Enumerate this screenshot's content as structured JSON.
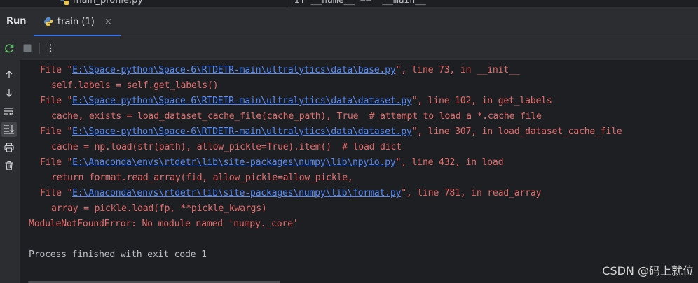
{
  "editor_strip": {
    "left_file": "main_profile.py",
    "right_code": "if __name__ == '__main__'"
  },
  "run_window": {
    "title": "Run",
    "tab_label": "train (1)",
    "tab_close": "×"
  },
  "icons": {
    "rerun": "rerun-icon",
    "stop": "stop-icon",
    "more": "more-vertical-icon",
    "up": "arrow-up-icon",
    "down": "arrow-down-icon",
    "wrap": "soft-wrap-icon",
    "scroll_end": "scroll-to-end-icon",
    "print": "print-icon",
    "clear": "trash-icon"
  },
  "colors": {
    "error": "#e06c6c",
    "link": "#548af7",
    "normal": "#bcbec4",
    "accent": "#3574f0"
  },
  "console": {
    "lines": [
      {
        "pre": "File \"",
        "link": "E:\\Space-python\\Space-6\\RTDETR-main\\ultralytics\\data\\base.py",
        "post": "\", line 73, in __init__"
      },
      {
        "text": "self.labels = self.get_labels()"
      },
      {
        "pre": "File \"",
        "link": "E:\\Space-python\\Space-6\\RTDETR-main\\ultralytics\\data\\dataset.py",
        "post": "\", line 102, in get_labels"
      },
      {
        "text": "cache, exists = load_dataset_cache_file(cache_path), True  # attempt to load a *.cache file"
      },
      {
        "pre": "File \"",
        "link": "E:\\Space-python\\Space-6\\RTDETR-main\\ultralytics\\data\\dataset.py",
        "post": "\", line 307, in load_dataset_cache_file"
      },
      {
        "text": "cache = np.load(str(path), allow_pickle=True).item()  # load dict"
      },
      {
        "pre": "File \"",
        "link": "E:\\Anaconda\\envs\\rtdetr\\lib\\site-packages\\numpy\\lib\\npyio.py",
        "post": "\", line 432, in load"
      },
      {
        "text": "return format.read_array(fid, allow_pickle=allow_pickle,"
      },
      {
        "pre": "File \"",
        "link": "E:\\Anaconda\\envs\\rtdetr\\lib\\site-packages\\numpy\\lib\\format.py",
        "post": "\", line 781, in read_array"
      },
      {
        "text": "array = pickle.load(fp, **pickle_kwargs)"
      },
      {
        "text": "ModuleNotFoundError: No module named 'numpy._core'"
      },
      {
        "text": ""
      },
      {
        "text": "Process finished with exit code 1"
      }
    ]
  },
  "watermark": "CSDN @码上就位"
}
